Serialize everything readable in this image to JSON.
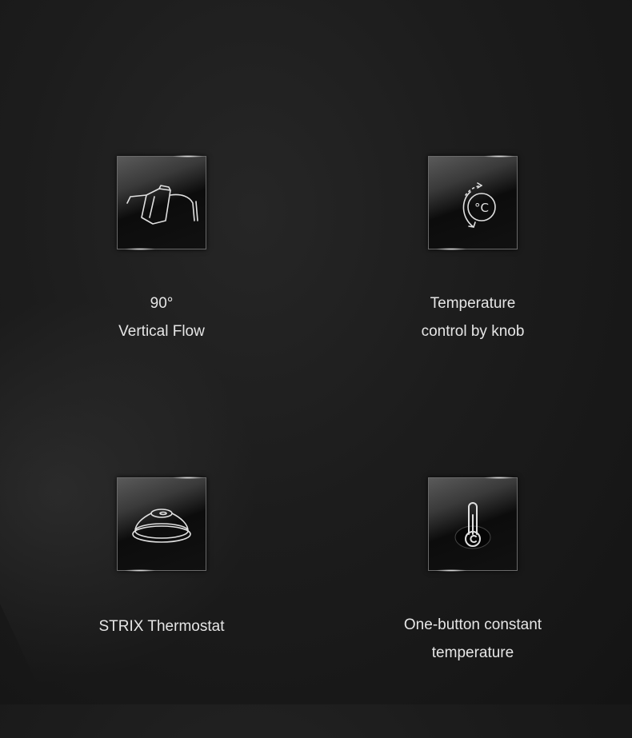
{
  "features": [
    {
      "icon": "gooseneck-kettle-icon",
      "line1": "90°",
      "line2": "Vertical Flow"
    },
    {
      "icon": "temperature-knob-icon",
      "line1": "Temperature",
      "line2": "control by knob",
      "icon_text": "°C"
    },
    {
      "icon": "thermostat-icon",
      "line1": "STRIX Thermostat"
    },
    {
      "icon": "thermometer-button-icon",
      "line1": "One-button constant",
      "line2": "temperature"
    }
  ],
  "colors": {
    "background": "#1c1c1c",
    "text": "#e6e6e6",
    "icon_stroke": "#e0e0e0"
  }
}
